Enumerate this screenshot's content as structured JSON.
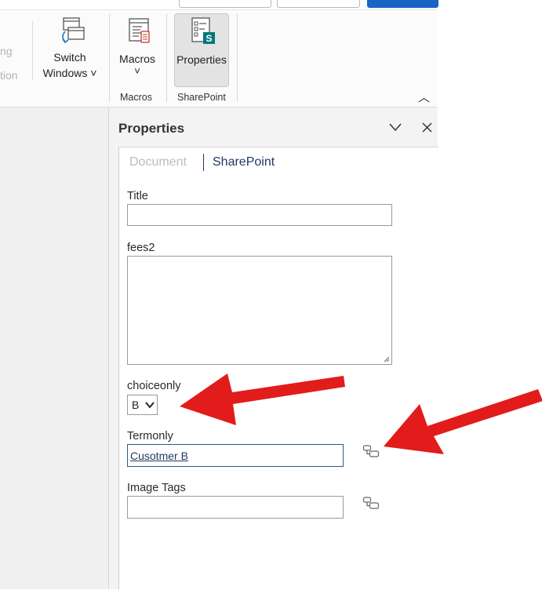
{
  "ribbon": {
    "faded_top": "ng",
    "faded_bottom": "tion",
    "switch_windows": {
      "line1": "Switch",
      "line2": "Windows ˅"
    },
    "macros": {
      "label": "Macros",
      "chevron": "˅"
    },
    "properties": {
      "label": "Properties"
    },
    "groups": {
      "macros": "Macros",
      "sharepoint": "SharePoint"
    },
    "collapse_glyph": "︿"
  },
  "pane": {
    "title": "Properties",
    "chevron_glyph": "﹀",
    "close_glyph": "✕",
    "tabs": [
      {
        "label": "Document",
        "active": false
      },
      {
        "label": "SharePoint",
        "active": true
      }
    ],
    "fields": {
      "title": {
        "label": "Title",
        "value": ""
      },
      "fees2": {
        "label": "fees2",
        "value": ""
      },
      "choiceonly": {
        "label": "choiceonly",
        "value": "B"
      },
      "termonly": {
        "label": "Termonly",
        "value": "Cusotmer B"
      },
      "image_tags": {
        "label": "Image Tags",
        "value": ""
      }
    }
  },
  "colors": {
    "arrow_red": "#e21b1b",
    "sharepoint_teal": "#03787c",
    "tab_active": "#1f3864",
    "tab_inactive": "#b8b8b8"
  },
  "icons": [
    "switch-windows-icon",
    "macros-icon",
    "sharepoint-properties-icon",
    "managed-metadata-icon"
  ]
}
